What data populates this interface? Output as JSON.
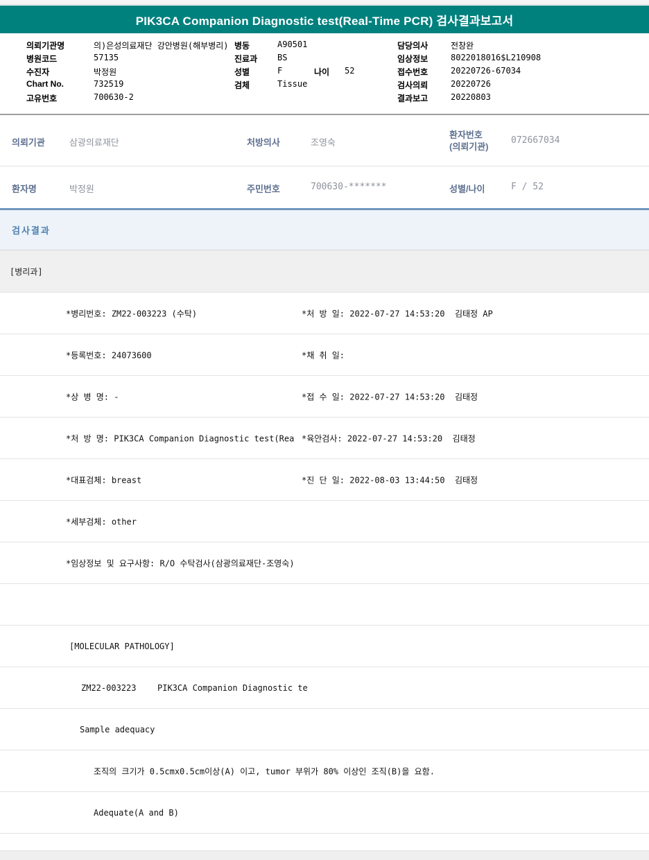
{
  "title_bar": {
    "title": "PIK3CA Companion Diagnostic test(Real-Time PCR) 검사결과보고서"
  },
  "colors": {
    "teal_header": "#00817e",
    "section_heading_bg": "#edf3f9",
    "section_heading_text": "#4d7fae",
    "label_blue_gray": "#5f7190",
    "value_gray": "#8e939c",
    "divider_blue": "#7096bc",
    "dept_band_bg": "#f0f0f0"
  },
  "header_info": {
    "rows": [
      {
        "c1l": "의뢰기관명",
        "c1v": "의)은성의료재단 강안병원(해부병리)",
        "c2l": "병동",
        "c2v": "A90501",
        "c3l": "",
        "c3v": "",
        "c4l": "담당의사",
        "c4v": "전창완"
      },
      {
        "c1l": "병원코드",
        "c1v": "57135",
        "c2l": "진료과",
        "c2v": "BS",
        "c3l": "",
        "c3v": "",
        "c4l": "임상정보",
        "c4v": "8022018016$L210908"
      },
      {
        "c1l": "수진자",
        "c1v": "박정원",
        "c2l": "성별",
        "c2v": "F",
        "c3l": "나이",
        "c3v": "52",
        "c4l": "접수번호",
        "c4v": "20220726-67034"
      },
      {
        "c1l": "Chart No.",
        "c1v": "732519",
        "c2l": "검체",
        "c2v": "Tissue",
        "c3l": "",
        "c3v": "",
        "c4l": "검사의뢰",
        "c4v": "20220726"
      },
      {
        "c1l": "고유번호",
        "c1v": "700630-2",
        "c2l": "",
        "c2v": "",
        "c3l": "",
        "c3v": "",
        "c4l": "결과보고",
        "c4v": "20220803"
      }
    ]
  },
  "referral": {
    "row1": {
      "l1": "의뢰기관",
      "v1": "삼광의료재단",
      "l2": "처방의사",
      "v2": "조영숙",
      "l3_line1": "환자번호",
      "l3_line2": "(의뢰기관)",
      "v3": "072667034"
    },
    "row2": {
      "l1": "환자명",
      "v1": "박정원",
      "l2": "주민번호",
      "v2": "700630-*******",
      "l3": "성별/나이",
      "v3": "F / 52"
    }
  },
  "results": {
    "heading": "검사결과",
    "department": "[병리과]",
    "rows": [
      {
        "left": "*병리번호: ZM22-003223 (수탁)",
        "right": "*처 방 일: 2022-07-27 14:53:20  김태정 AP"
      },
      {
        "left": "*등록번호: 24073600",
        "right": "*채 취 일:"
      },
      {
        "left": "*상 병 명: -",
        "right": "*접 수 일: 2022-07-27 14:53:20  김태정"
      },
      {
        "left": "*처 방 명: PIK3CA Companion Diagnostic test(Rea",
        "right": "*육안검사: 2022-07-27 14:53:20  김태정"
      },
      {
        "left": "*대표검체: breast",
        "right": "*진 단 일: 2022-08-03 13:44:50  김태정"
      },
      {
        "left": "*세부검체: other",
        "right": ""
      },
      {
        "left": "*임상정보 및 요구사항: R/O 수탁검사(삼광의료재단-조영숙)",
        "right": ""
      }
    ],
    "molecular": {
      "section_label": "[MOLECULAR PATHOLOGY]",
      "specimen_no": "ZM22-003223",
      "test_name": "PIK3CA Companion Diagnostic te",
      "sample_adequacy_label": "Sample adequacy",
      "adequacy_criteria": "조직의 크기가 0.5cmx0.5cm이상(A) 이고, tumor 부위가 80% 이상인 조직(B)을 요함.",
      "adequacy_result": "Adequate(A and B)"
    }
  }
}
